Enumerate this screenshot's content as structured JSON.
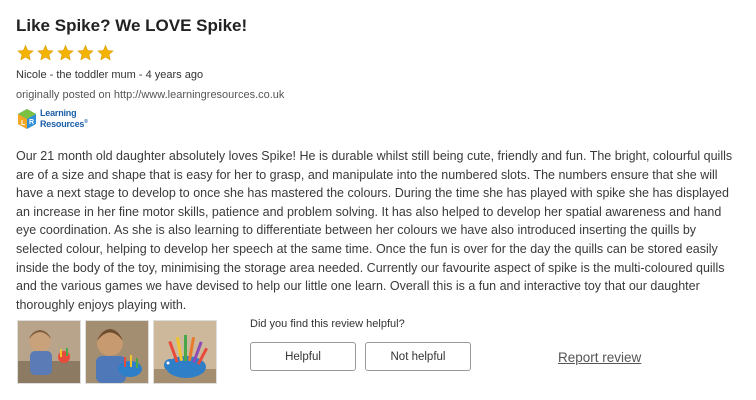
{
  "review": {
    "title": "Like Spike? We LOVE Spike!",
    "rating": 5,
    "rating_max": 5,
    "star_color": "#f5b301",
    "author_line": "Nicole - the toddler mum - 4 years ago",
    "source_line": "originally posted on http://www.learningresources.co.uk",
    "source_logo": {
      "line1": "Learning",
      "line2": "Resources",
      "mark": "®"
    },
    "body": "Our 21 month old daughter absolutely loves Spike! He is durable whilst still being cute, friendly and fun. The bright, colourful quills are of a size and shape that is easy for her to grasp, and manipulate into the numbered slots. The numbers ensure that she will have a next stage to develop to once she has mastered the colours. During the time she has played with spike she has displayed an increase in her fine motor skills, patience and problem solving. It has also helped to develop her spatial awareness and hand eye coordination. As she is also learning to differentiate between her colours we have also introduced inserting the quills by selected colour, helping to develop her speech at the same time. Once the fun is over for the day the quills can be stored easily inside the body of the toy, minimising the storage area needed. Currently our favourite aspect of spike is the multi-coloured quills and the various games we have devised to help our little one learn. Overall this is a fun and interactive toy that our daughter thoroughly enjoys playing with.",
    "photos": [
      "toddler-playing-photo-1",
      "toddler-playing-photo-2",
      "spike-hedgehog-toy-photo"
    ]
  },
  "feedback": {
    "question": "Did you find this review helpful?",
    "helpful_label": "Helpful",
    "not_helpful_label": "Not helpful",
    "report_label": "Report review"
  }
}
